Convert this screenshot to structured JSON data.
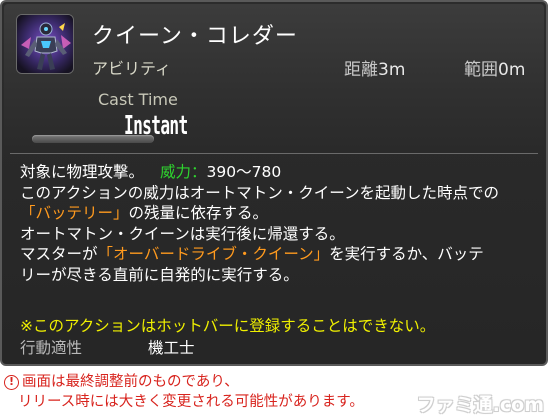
{
  "tooltip": {
    "title": "クイーン・コレダー",
    "category": "アビリティ",
    "range_label": "距離",
    "range_value": "3m",
    "radius_label": "範囲",
    "radius_value": "0m",
    "cast_label": "Cast Time",
    "cast_value": "Instant",
    "icon": "queen-automaton-icon",
    "description": {
      "line1_text": "対象に物理攻撃。",
      "potency_label": "威力：",
      "potency_value": "390〜780",
      "line2": "このアクションの威力はオートマトン・クイーンを起動した時点での",
      "line3_highlight": "「バッテリー」",
      "line3_rest": "の残量に依存する。",
      "line4": "オートマトン・クイーンは実行後に帰還する。",
      "line5_pre": "マスターが",
      "line5_highlight": "「オーバードライブ・クイーン」",
      "line5_post": "を実行するか、バッテ",
      "line6": "リーが尽きる直前に自発的に実行する。"
    },
    "note": "※このアクションはホットバーに登録することはできない。",
    "job_label": "行動適性",
    "job_value": "機工士"
  },
  "disclaimer": {
    "icon": "exclamation-icon",
    "line1": "画面は最終調整前のものであり、",
    "line2": "リリース時には大きく変更される可能性があります。"
  },
  "watermark": "ファミ通.com",
  "colors": {
    "tooltip_bg": "#2a2a2a",
    "highlight_orange": "#ff9a1e",
    "potency_green": "#2ed42e",
    "note_yellow": "#f0f000",
    "warning_red": "#d8241e"
  }
}
